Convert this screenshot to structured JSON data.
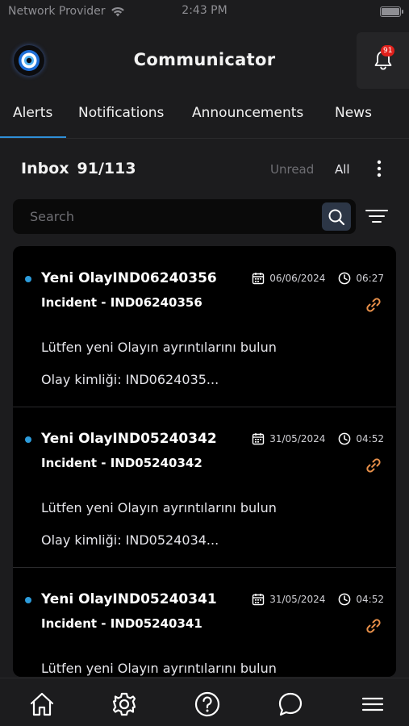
{
  "status_bar": {
    "carrier": "Network Provider",
    "time": "2:43 PM"
  },
  "header": {
    "title": "Communicator",
    "notification_badge": "91"
  },
  "tabs": [
    {
      "label": "Alerts",
      "active": true
    },
    {
      "label": "Notifications",
      "active": false
    },
    {
      "label": "Announcements",
      "active": false
    },
    {
      "label": "News",
      "active": false
    }
  ],
  "inbox": {
    "title": "Inbox",
    "count": "91/113",
    "filter_unread": "Unread",
    "filter_all": "All"
  },
  "search": {
    "placeholder": "Search",
    "value": ""
  },
  "items": [
    {
      "title": "Yeni OlayIND06240356",
      "subtitle": "Incident - IND06240356",
      "date": "06/06/2024",
      "time": "06:27",
      "body_line1": "Lütfen yeni Olayın ayrıntılarını bulun",
      "body_line2": "Olay kimliği: IND0624035...",
      "unread": true
    },
    {
      "title": "Yeni OlayIND05240342",
      "subtitle": "Incident - IND05240342",
      "date": "31/05/2024",
      "time": "04:52",
      "body_line1": "Lütfen yeni Olayın ayrıntılarını bulun",
      "body_line2": "Olay kimliği: IND0524034...",
      "unread": true
    },
    {
      "title": "Yeni OlayIND05240341",
      "subtitle": "Incident - IND05240341",
      "date": "31/05/2024",
      "time": "04:52",
      "body_line1": "Lütfen yeni Olayın ayrıntılarını bulun",
      "body_line2": "",
      "unread": true
    }
  ],
  "bottom_nav": [
    {
      "icon": "home-icon"
    },
    {
      "icon": "gear-icon"
    },
    {
      "icon": "help-icon"
    },
    {
      "icon": "chat-icon"
    },
    {
      "icon": "menu-icon"
    }
  ],
  "colors": {
    "accent": "#2f8fd8",
    "unread_dot": "#2d9cdb",
    "link_icon": "#e8904a",
    "badge": "#e0201b"
  }
}
